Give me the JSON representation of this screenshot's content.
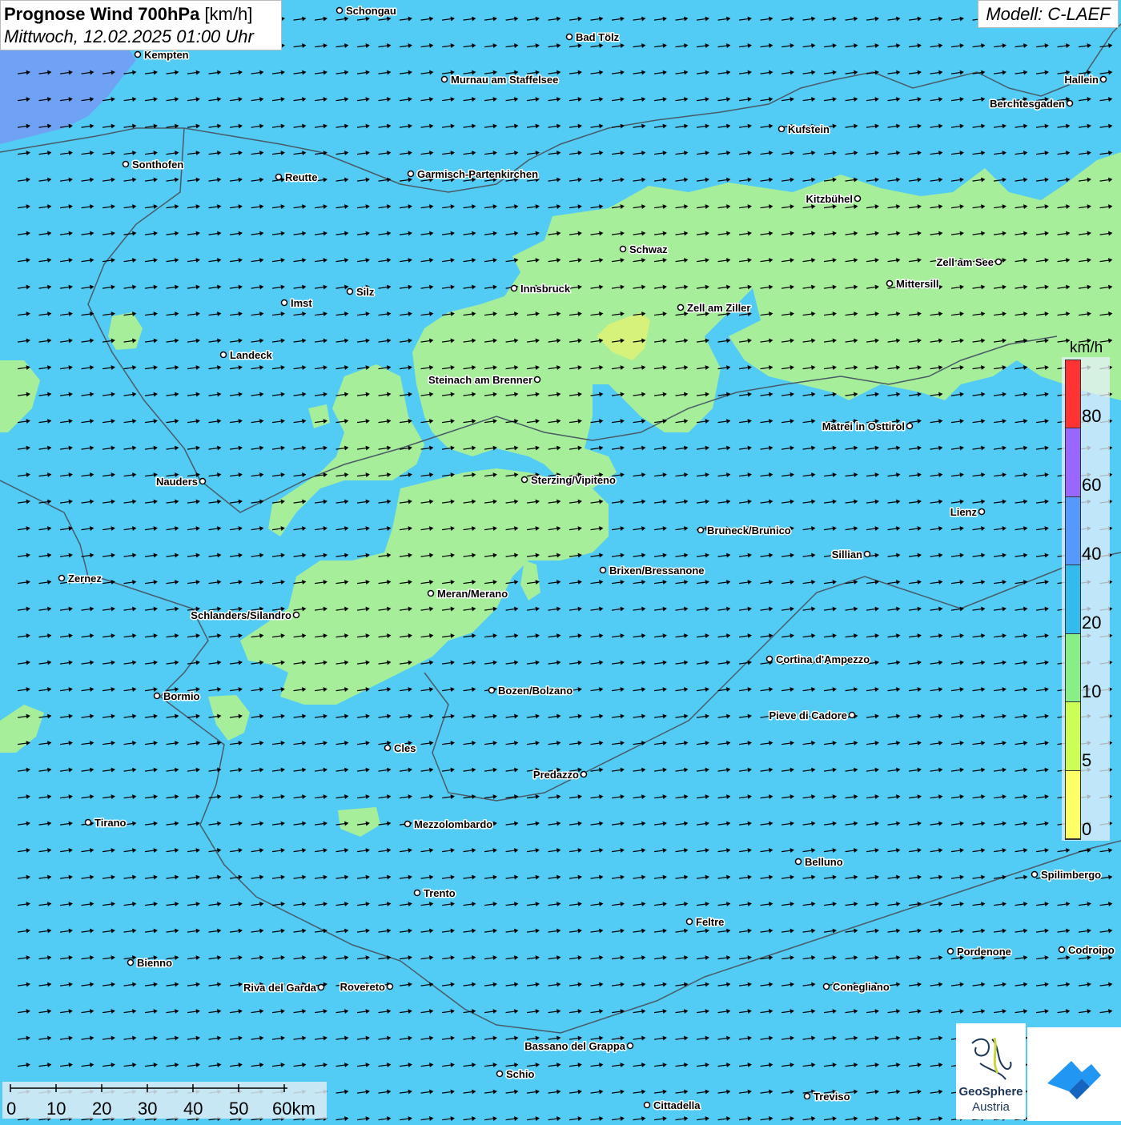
{
  "title": {
    "bold": "Prognose Wind 700hPa",
    "unit": "[km/h]",
    "datetime": "Mittwoch, 12.02.2025 01:00 Uhr"
  },
  "model": "Modell: C-LAEF",
  "colors": {
    "background": "#52ccf5",
    "green_area": "#a6ee9a",
    "yellowgreen_area": "#d6f27a",
    "blue_area": "#6fa2f4",
    "border_line": "#4a5a66",
    "arrow": "#000000"
  },
  "legend": {
    "unit": "km/h",
    "bins": [
      {
        "from": 0,
        "to": 5,
        "color": "#ffff66"
      },
      {
        "from": 5,
        "to": 10,
        "color": "#ccff55"
      },
      {
        "from": 10,
        "to": 20,
        "color": "#88ee88"
      },
      {
        "from": 20,
        "to": 40,
        "color": "#33bbee"
      },
      {
        "from": 40,
        "to": 60,
        "color": "#5599ff"
      },
      {
        "from": 60,
        "to": 80,
        "color": "#9966ff"
      },
      {
        "from": 80,
        "to": 100,
        "color": "#ff3333"
      }
    ],
    "labels": [
      "0",
      "5",
      "10",
      "20",
      "40",
      "60",
      "80"
    ]
  },
  "wind_direction": "west-southwest",
  "scale_bar": {
    "labels": [
      "0",
      "10",
      "20",
      "30",
      "40",
      "50",
      "60km"
    ]
  },
  "logos": {
    "geosphere_line1": "GeoSphere",
    "geosphere_line2": "Austria"
  },
  "cities": [
    {
      "name": "Schongau"
    },
    {
      "name": "Bad Tölz"
    },
    {
      "name": "Kempten"
    },
    {
      "name": "Murnau am Staffelsee"
    },
    {
      "name": "Hallein"
    },
    {
      "name": "Berchtesgaden"
    },
    {
      "name": "Kufstein"
    },
    {
      "name": "Sonthofen"
    },
    {
      "name": "Reutte"
    },
    {
      "name": "Garmisch-Partenkirchen"
    },
    {
      "name": "Kitzbühel"
    },
    {
      "name": "Schwaz"
    },
    {
      "name": "Zell am See"
    },
    {
      "name": "Innsbruck"
    },
    {
      "name": "Mittersill"
    },
    {
      "name": "Silz"
    },
    {
      "name": "Imst"
    },
    {
      "name": "Zell am Ziller"
    },
    {
      "name": "Landeck"
    },
    {
      "name": "Steinach am Brenner"
    },
    {
      "name": "Matrei in Osttirol"
    },
    {
      "name": "Nauders"
    },
    {
      "name": "Sterzing/Vipiteno"
    },
    {
      "name": "Lienz"
    },
    {
      "name": "Bruneck/Brunico"
    },
    {
      "name": "Sillian"
    },
    {
      "name": "Brixen/Bressanone"
    },
    {
      "name": "Zernez"
    },
    {
      "name": "Meran/Merano"
    },
    {
      "name": "Schlanders/Silandro"
    },
    {
      "name": "Cortina d'Ampezzo"
    },
    {
      "name": "Bozen/Bolzano"
    },
    {
      "name": "Bormio"
    },
    {
      "name": "Pieve di Cadore"
    },
    {
      "name": "Cles"
    },
    {
      "name": "Predazzo"
    },
    {
      "name": "Tirano"
    },
    {
      "name": "Mezzolombardo"
    },
    {
      "name": "Belluno"
    },
    {
      "name": "Spilimbergo"
    },
    {
      "name": "Trento"
    },
    {
      "name": "Feltre"
    },
    {
      "name": "Bienno"
    },
    {
      "name": "Pordenone"
    },
    {
      "name": "Codroipo"
    },
    {
      "name": "Riva del Garda"
    },
    {
      "name": "Rovereto"
    },
    {
      "name": "Conegliano"
    },
    {
      "name": "Bassano del Grappa"
    },
    {
      "name": "Schio"
    },
    {
      "name": "Treviso"
    },
    {
      "name": "Cittadella"
    }
  ]
}
